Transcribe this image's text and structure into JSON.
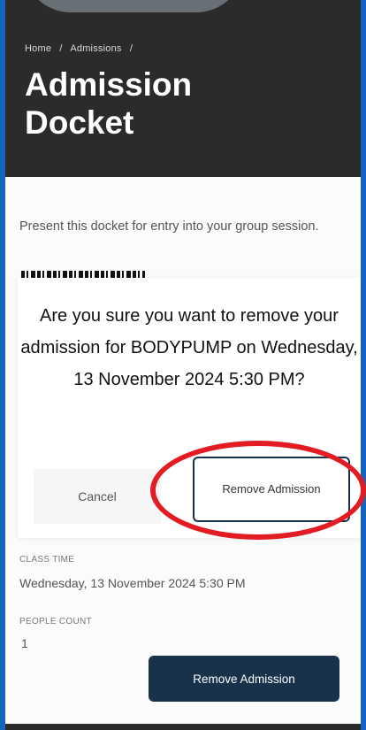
{
  "breadcrumb": {
    "home": "Home",
    "separator": "/",
    "admissions": "Admissions",
    "trail_end": "/"
  },
  "page_title": "Admission Docket",
  "intro_text": "Present this docket for entry into your group session.",
  "modal": {
    "message": "Are you sure you want to remove your admission for BODYPUMP on Wednesday, 13 November 2024 5:30 PM?",
    "cancel_label": "Cancel",
    "confirm_label": "Remove Admission"
  },
  "details": {
    "class_time_label": "CLASS TIME",
    "class_time_value": "Wednesday, 13 November 2024 5:30 PM",
    "people_count_label": "PEOPLE COUNT",
    "people_count_value": "1"
  },
  "actions": {
    "remove_label": "Remove Admission"
  },
  "colors": {
    "accent": "#18324b",
    "frame": "#1565c0",
    "highlight": "#e31b23",
    "hero": "#2b2b2b"
  }
}
